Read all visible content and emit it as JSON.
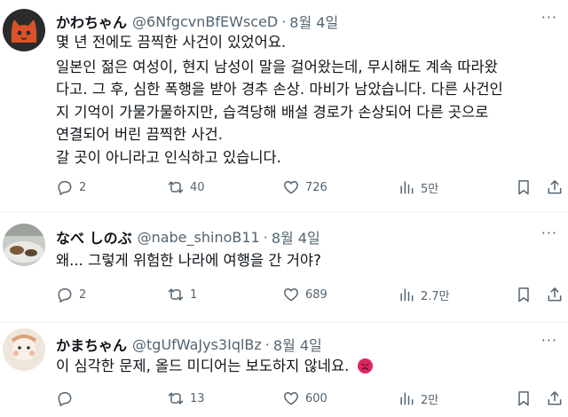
{
  "tweets": [
    {
      "name": "かわちゃん",
      "handle": "@6NfgcvnBfEWsceD",
      "sep": "·",
      "date": "8월 4일",
      "lines": [
        "몇 년 전에도 끔찍한 사건이 있었어요.",
        "일본인 젊은 여성이, 현지 남성이 말을 걸어왔는데, 무시해도 계속 따라왔",
        "다고. 그 후, 심한 폭행을 받아 경추 손상. 마비가 남았습니다. 다른 사건인",
        "지 기억이 가물가물하지만, 습격당해 배설 경로가 손상되어 다른 곳으로",
        "연결되어 버린 끔찍한 사건.",
        "갈 곳이 아니라고 인식하고 있습니다."
      ],
      "replies": "2",
      "retweets": "40",
      "likes": "726",
      "views": "5만"
    },
    {
      "name": "なべ しのぶ",
      "handle": "@nabe_shinoB11",
      "sep": "·",
      "date": "8월 4일",
      "lines": [
        "왜... 그렇게 위험한 나라에 여행을 간 거야?"
      ],
      "replies": "2",
      "retweets": "1",
      "likes": "689",
      "views": "2.7만"
    },
    {
      "name": "かまちゃん",
      "handle": "@tgUfWaJys3IqlBz",
      "sep": "·",
      "date": "8월 4일",
      "lines": [
        "이 심각한 문제, 올드 미디어는 보도하지 않네요."
      ],
      "emoji": "angry-face",
      "replies": "",
      "retweets": "13",
      "likes": "600",
      "views": "2만"
    }
  ],
  "more_label": "···"
}
